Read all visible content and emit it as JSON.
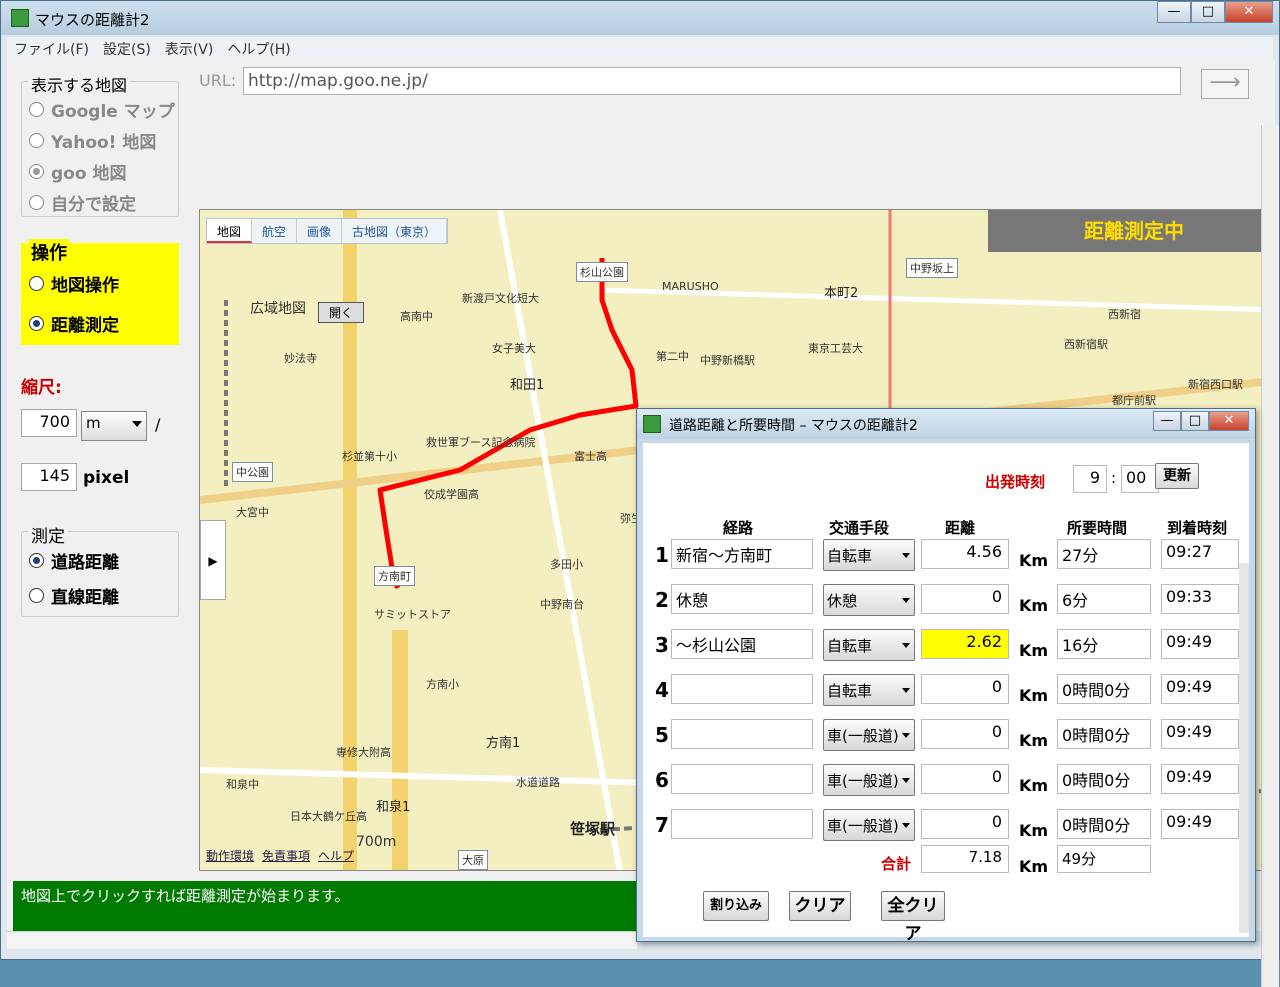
{
  "window": {
    "title": "マウスの距離計2"
  },
  "menu": [
    "ファイル(F)",
    "設定(S)",
    "表示(V)",
    "ヘルプ(H)"
  ],
  "map_source": {
    "title": "表示する地図",
    "options": [
      "Google マップ",
      "Yahoo! 地図",
      "goo 地図",
      "自分で設定"
    ],
    "selected": "goo 地図"
  },
  "operation": {
    "title": "操作",
    "options": [
      "地図操作",
      "距離測定"
    ],
    "selected": "距離測定"
  },
  "scale": {
    "label": "縮尺:",
    "distance": "700",
    "unit": "m",
    "slash": "/",
    "pixels": "145",
    "pixel_label": "pixel"
  },
  "measure": {
    "title": "測定",
    "options": [
      "道路距離",
      "直線距離"
    ],
    "selected": "道路距離"
  },
  "url": {
    "label": "URL:",
    "value": "http://map.goo.ne.jp/"
  },
  "map": {
    "tabs": [
      "地図",
      "航空",
      "画像",
      "古地図（東京）"
    ],
    "status_banner": "距離測定中",
    "footer": [
      "動作環境",
      "免責事項",
      "ヘルプ"
    ],
    "wide_map_label": "広域地図",
    "open_label": "開く",
    "scale_label": "700m",
    "labels": [
      "杉山公園",
      "中野坂上",
      "和田1",
      "第二中",
      "中野新橋駅",
      "富士高",
      "方南町",
      "笹塚駅",
      "大原",
      "方南1",
      "和泉1",
      "中野南台",
      "東京工芸大",
      "本町2",
      "弥生町",
      "新宿西口駅",
      "西新宿",
      "都庁前駅",
      "西新宿駅",
      "中公園",
      "大宮中",
      "妙法寺",
      "高南中",
      "女子美大",
      "救世軍ブース記念病院",
      "佼成学園高",
      "MARUSHO",
      "新渡戸文化短大",
      "方南小",
      "水道道路",
      "日本大鶴ケ丘高",
      "専修大附高",
      "和泉中",
      "杉並第十小",
      "サミットストア",
      "多田小"
    ]
  },
  "statusbar": {
    "text": "地図上でクリックすれば距離測定が始まります。"
  },
  "dialog": {
    "title": "道路距離と所要時間 – マウスの距離計2",
    "departure_label": "出発時刻",
    "departure_hour": "9",
    "departure_sep": ":",
    "departure_min": "00",
    "update_button": "更新",
    "headers": {
      "route": "経路",
      "transport": "交通手段",
      "distance": "距離",
      "duration": "所要時間",
      "arrival": "到着時刻"
    },
    "rows": [
      {
        "num": "1",
        "route": "新宿〜方南町",
        "transport": "自転車",
        "distance": "4.56",
        "unit": "Km",
        "duration": "27分",
        "arrival": "09:27"
      },
      {
        "num": "2",
        "route": "休憩",
        "transport": "休憩",
        "distance": "0",
        "unit": "Km",
        "duration": "6分",
        "arrival": "09:33"
      },
      {
        "num": "3",
        "route": "〜杉山公園",
        "transport": "自転車",
        "distance": "2.62",
        "unit": "Km",
        "duration": "16分",
        "arrival": "09:49"
      },
      {
        "num": "4",
        "route": "",
        "transport": "自転車",
        "distance": "0",
        "unit": "Km",
        "duration": "0時間0分",
        "arrival": "09:49"
      },
      {
        "num": "5",
        "route": "",
        "transport": "車(一般道)",
        "distance": "0",
        "unit": "Km",
        "duration": "0時間0分",
        "arrival": "09:49"
      },
      {
        "num": "6",
        "route": "",
        "transport": "車(一般道)",
        "distance": "0",
        "unit": "Km",
        "duration": "0時間0分",
        "arrival": "09:49"
      },
      {
        "num": "7",
        "route": "",
        "transport": "車(一般道)",
        "distance": "0",
        "unit": "Km",
        "duration": "0時間0分",
        "arrival": "09:49"
      }
    ],
    "total_label": "合計",
    "total_distance": "7.18",
    "total_unit": "Km",
    "total_duration": "49分",
    "buttons": {
      "insert": "割り込み",
      "clear": "クリア",
      "clear_all": "全クリア"
    }
  },
  "colors": {
    "route_line": "#ff0000",
    "highlight": "#ffff00",
    "status_bg": "#007a00",
    "banner_text": "#ffdd00"
  }
}
